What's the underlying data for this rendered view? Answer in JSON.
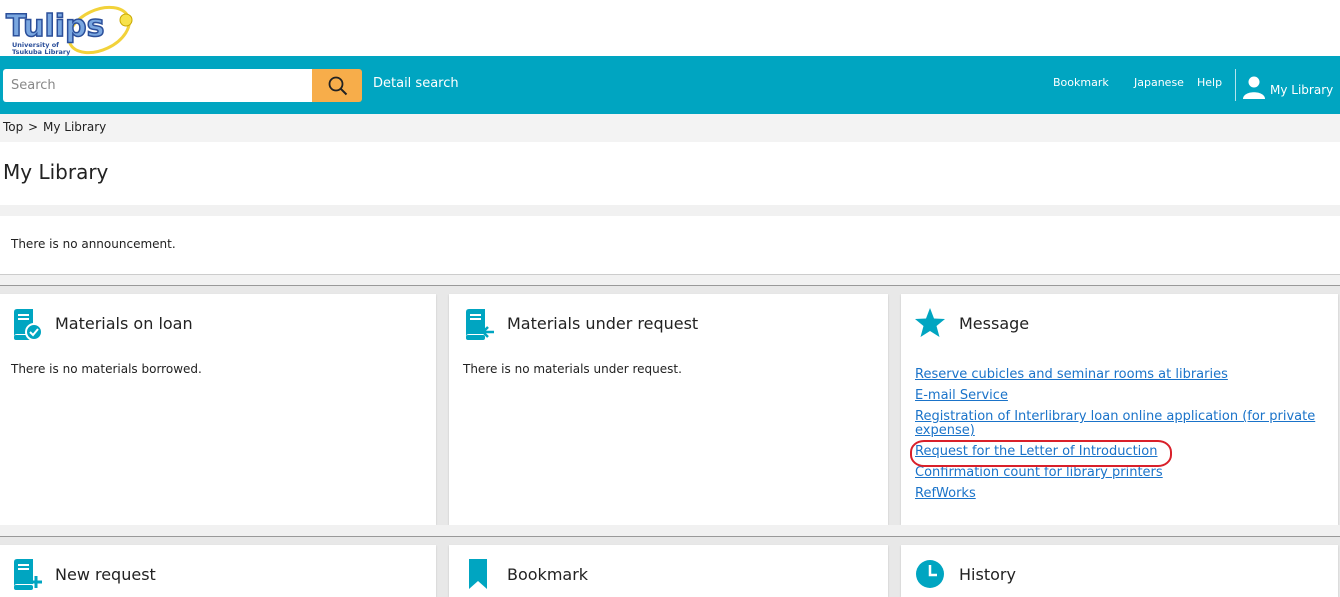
{
  "logo": {
    "name": "Tulips",
    "subtitle_line1": "University of",
    "subtitle_line2": "Tsukuba Library"
  },
  "header": {
    "search_placeholder": "Search",
    "detail_search": "Detail search",
    "bookmark": "Bookmark",
    "japanese": "Japanese",
    "help": "Help",
    "my_library": "My Library"
  },
  "breadcrumb": {
    "top": "Top",
    "separator": ">",
    "current": "My Library"
  },
  "page_title": "My Library",
  "announcement": "There is no announcement.",
  "cards": {
    "loan": {
      "title": "Materials on loan",
      "body": "There is no materials borrowed.",
      "icon": "book-check-icon"
    },
    "request": {
      "title": "Materials under request",
      "body": "There is no materials under request.",
      "icon": "book-arrow-icon"
    },
    "message": {
      "title": "Message",
      "icon": "star-icon",
      "links": [
        "Reserve cubicles and seminar rooms at libraries",
        "E-mail Service",
        "Registration of Interlibrary loan online application (for private expense)",
        "Request for the Letter of Introduction",
        "Confirmation count for library printers",
        "RefWorks"
      ]
    },
    "new_request": {
      "title": "New request",
      "icon": "book-plus-icon"
    },
    "bookmark": {
      "title": "Bookmark",
      "icon": "bookmark-icon"
    },
    "history": {
      "title": "History",
      "icon": "clock-icon"
    }
  },
  "colors": {
    "nav": "#00a5c1",
    "search_button": "#f7ad4a",
    "link": "#1a73c9",
    "icon": "#00a5c1",
    "highlight": "#d9202a"
  }
}
